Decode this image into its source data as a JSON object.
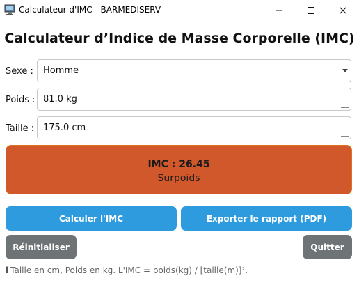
{
  "window": {
    "title": "Calculateur d'IMC - BARMEDISERV"
  },
  "heading": "Calculateur d’Indice de Masse Corporelle (IMC)",
  "form": {
    "sexe": {
      "label": "Sexe :",
      "value": "Homme"
    },
    "poids": {
      "label": "Poids :",
      "value": "81.0 kg"
    },
    "taille": {
      "label": "Taille :",
      "value": "175.0 cm"
    }
  },
  "result": {
    "imc_text": "IMC : 26.45",
    "category": "Surpoids",
    "color": "#d0582b"
  },
  "buttons": {
    "calc": "Calculer l'IMC",
    "export": "Exporter le rapport (PDF)",
    "reset": "Réinitialiser",
    "quit": "Quitter"
  },
  "hint": {
    "icon": "info-icon",
    "text": "Taille en cm, Poids en kg. L'IMC = poids(kg) / [taille(m)]²."
  },
  "colors": {
    "accent": "#2d9bde",
    "secondary": "#6e7476"
  }
}
